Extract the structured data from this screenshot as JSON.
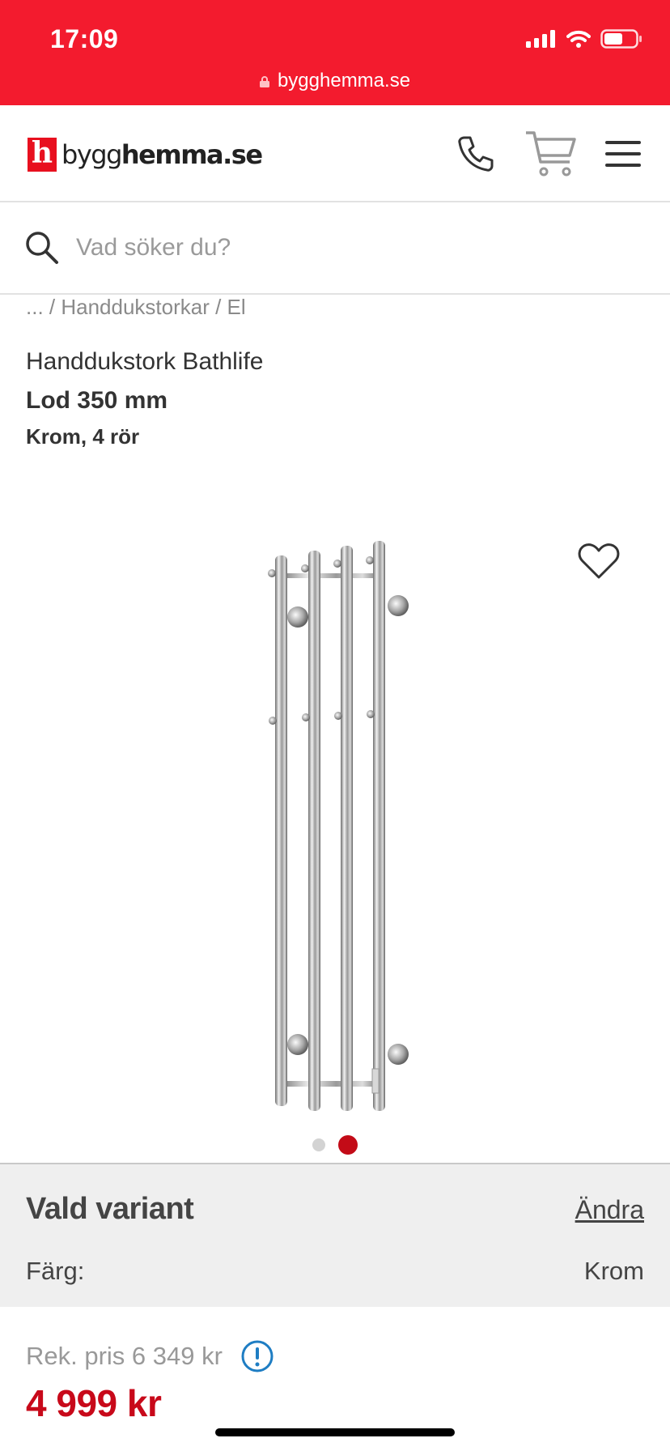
{
  "status_bar": {
    "time": "17:09",
    "url": "bygghemma.se"
  },
  "header": {
    "logo_letter": "h",
    "logo_text_light": "bygg",
    "logo_text_bold": "hemma",
    "logo_text_tld": ".se"
  },
  "search": {
    "placeholder": "Vad söker du?"
  },
  "breadcrumb": "... / Handdukstorkar / El",
  "product": {
    "brand_line": "Handdukstork Bathlife",
    "name": "Lod 350 mm",
    "variant_desc": "Krom, 4 rör"
  },
  "gallery": {
    "total_images": 2,
    "active_index": 1
  },
  "variant": {
    "title": "Vald variant",
    "change_label": "Ändra",
    "attribute_label": "Färg:",
    "attribute_value": "Krom"
  },
  "price": {
    "recommended": "Rek. pris 6 349 kr",
    "current": "4 999 kr"
  },
  "colors": {
    "brand_red": "#f31b2e",
    "price_red": "#c8091a",
    "info_blue": "#1e7dc3"
  },
  "icons": [
    "lock-icon",
    "phone-icon",
    "cart-icon",
    "menu-icon",
    "search-icon",
    "heart-icon",
    "info-icon"
  ]
}
